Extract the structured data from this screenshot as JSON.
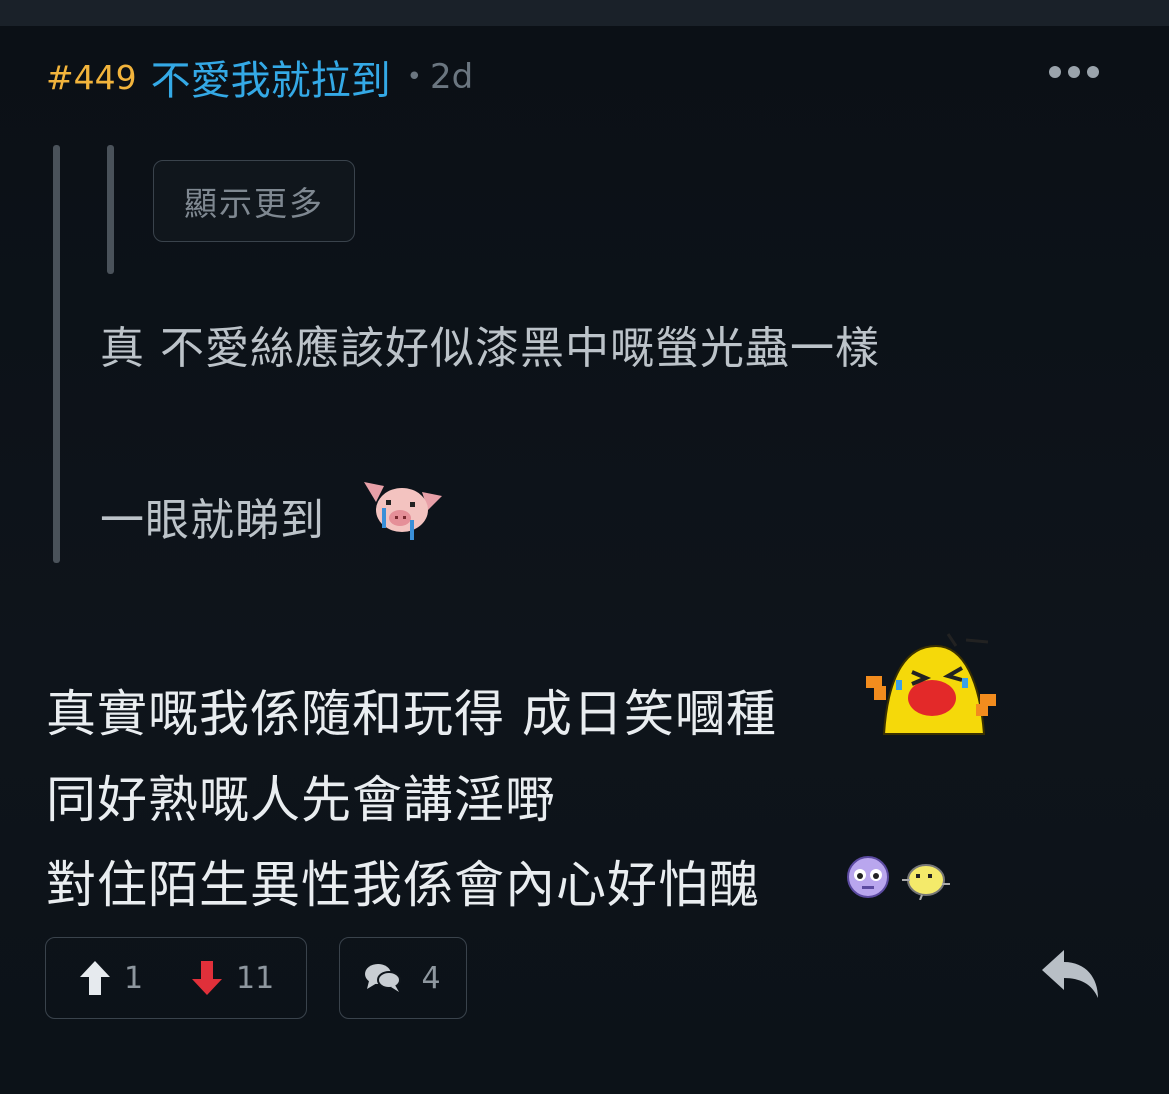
{
  "header": {
    "floor": "#449",
    "username": "不愛我就拉到",
    "separator": "•",
    "time": "2d"
  },
  "quote": {
    "show_more_label": "顯示更多",
    "lines": [
      "真 不愛絲應該好似漆黑中嘅螢光蟲一樣",
      "一眼就睇到"
    ]
  },
  "body": {
    "lines": [
      "真實嘅我係隨和玩得 成日笑嘓種",
      "同好熟嘅人先會講淫嘢",
      "對住陌生異性我係會內心好怕醜"
    ]
  },
  "actions": {
    "upvotes": "1",
    "downvotes": "11",
    "replies": "4"
  },
  "icons": {
    "more": "more-dots-icon",
    "upvote": "arrow-up-icon",
    "downvote": "arrow-down-icon",
    "comments": "speech-bubbles-icon",
    "reply": "reply-arrow-icon"
  },
  "colors": {
    "floor": "#f2b43c",
    "username": "#34a9e6",
    "downvote": "#e0303a",
    "background": "#0c1218"
  }
}
